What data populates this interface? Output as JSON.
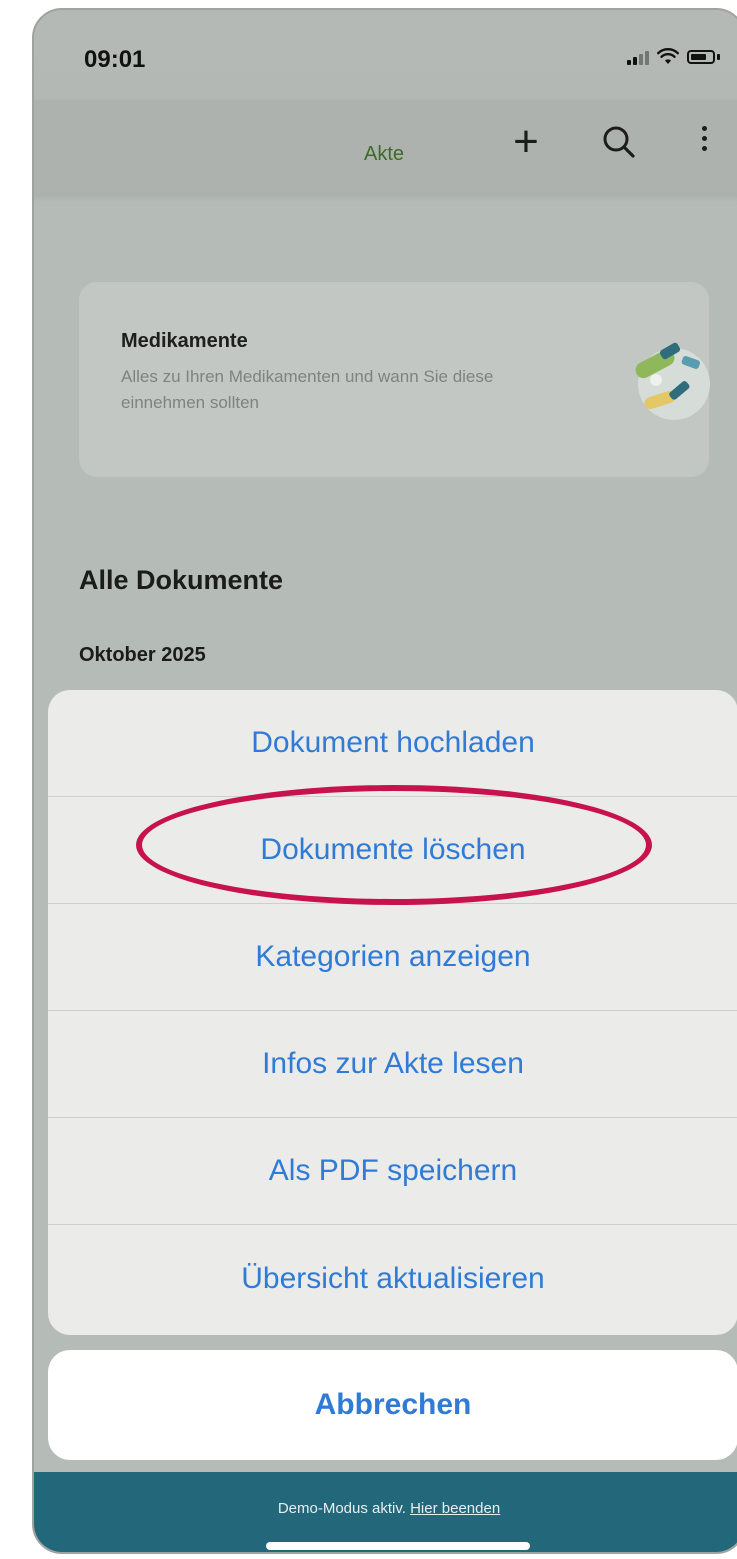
{
  "status_bar": {
    "time": "09:01"
  },
  "nav": {
    "title": "Akte",
    "add_icon": "plus-icon",
    "search_icon": "search-icon",
    "more_icon": "more-vertical-icon"
  },
  "med_card": {
    "title": "Medikamente",
    "description": "Alles zu Ihren Medikamenten und wann Sie diese einnehmen sollten",
    "illustration": "pills-illustration-icon"
  },
  "documents": {
    "section_title": "Alle Dokumente",
    "month": "Oktober 2025"
  },
  "action_sheet": {
    "items": [
      {
        "label": "Dokument hochladen"
      },
      {
        "label": "Dokumente löschen"
      },
      {
        "label": "Kategorien anzeigen"
      },
      {
        "label": "Infos zur Akte lesen"
      },
      {
        "label": "Als PDF speichern"
      },
      {
        "label": "Übersicht aktualisieren"
      }
    ],
    "cancel_label": "Abbrechen",
    "highlighted_item": "Dokumente löschen"
  },
  "demo_banner": {
    "text": "Demo-Modus aktiv.",
    "link": "Hier beenden"
  },
  "colors": {
    "accent_blue": "#2f7bd6",
    "highlight_red": "#c8124f",
    "banner_teal": "#23687a",
    "title_green": "#3d6b28"
  }
}
